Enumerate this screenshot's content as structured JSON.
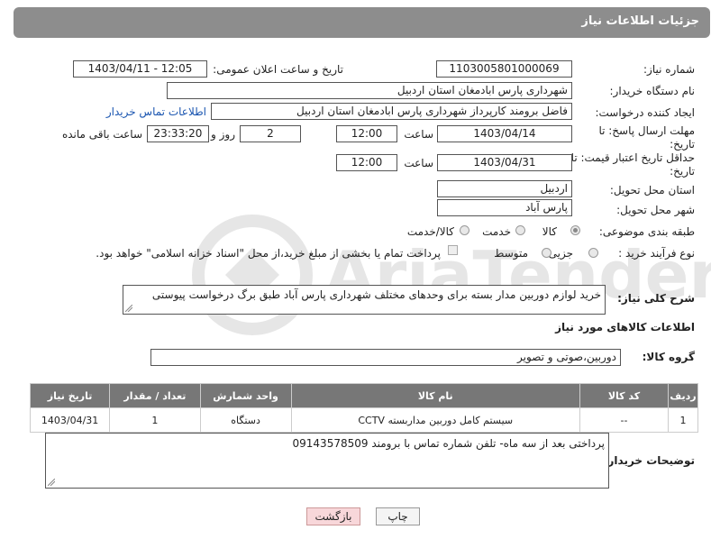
{
  "header": {
    "title": "جزئیات اطلاعات نیاز"
  },
  "form": {
    "need_number_label": "شماره نیاز:",
    "need_number": "1103005801000069",
    "announce_label": "تاریخ و ساعت اعلان عمومی:",
    "announce_value": "1403/04/11 - 12:05",
    "buyer_org_label": "نام دستگاه خریدار:",
    "buyer_org": "شهرداری پارس ابادمغان استان اردبیل",
    "creator_label": "ایجاد کننده درخواست:",
    "creator": "فاضل برومند کارپرداز شهرداری پارس ابادمغان استان اردبیل",
    "contact_link": "اطلاعات تماس خریدار",
    "reply_deadline_label": "مهلت ارسال پاسخ: تا تاریخ:",
    "reply_date": "1403/04/14",
    "time_label": "ساعت",
    "reply_time": "12:00",
    "days_value": "2",
    "days_label": "روز و",
    "remaining_time": "23:33:20",
    "remaining_label": "ساعت باقی مانده",
    "price_validity_label": "حداقل تاریخ اعتبار قیمت: تا تاریخ:",
    "price_date": "1403/04/31",
    "price_time": "12:00",
    "province_label": "استان محل تحویل:",
    "province": "اردبیل",
    "city_label": "شهر محل تحویل:",
    "city": "پارس آباد",
    "category_label": "طبقه بندی موضوعی:",
    "category_goods": "کالا",
    "category_service": "خدمت",
    "category_goods_service": "کالا/خدمت",
    "process_label": "نوع فرآیند خرید :",
    "process_small": "جزیی",
    "process_medium": "متوسط",
    "payment_note": "پرداخت تمام یا بخشی از مبلغ خرید،از محل \"اسناد خزانه اسلامی\" خواهد بود."
  },
  "description": {
    "label": "شرح کلی نیاز:",
    "text": "خرید لوازم دوربین مدار بسته برای وحدهای مختلف شهرداری پارس آباد طبق برگ درخواست پیوستی"
  },
  "goods_section": {
    "title": "اطلاعات کالاهای مورد نیاز",
    "group_label": "گروه کالا:",
    "group_value": "دوربین،صوتی و تصویر"
  },
  "table": {
    "headers": [
      "ردیف",
      "کد کالا",
      "نام کالا",
      "واحد شمارش",
      "تعداد / مقدار",
      "تاریخ نیاز"
    ],
    "rows": [
      [
        "1",
        "--",
        "سیستم کامل دوربین مداربسته CCTV",
        "دستگاه",
        "1",
        "1403/04/31"
      ]
    ]
  },
  "buyer_notes": {
    "label": "توضیحات خریدار:",
    "text": "پرداختی بعد از سه ماه- تلفن شماره تماس با برومند 09143578509"
  },
  "buttons": {
    "print": "چاپ",
    "back": "بازگشت"
  },
  "watermark": {
    "text": "AriaTender.net"
  }
}
